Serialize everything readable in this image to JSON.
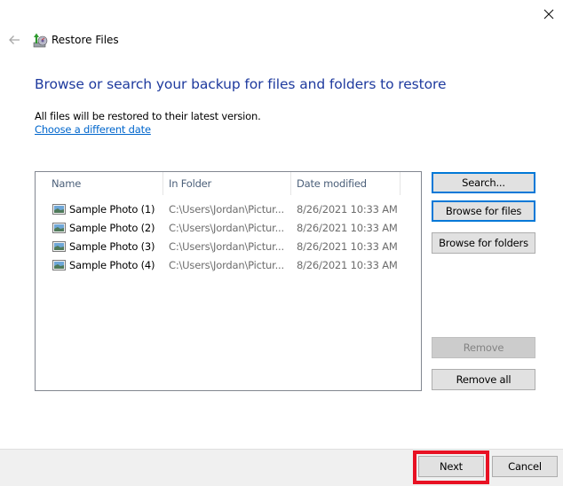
{
  "window": {
    "title": "Restore Files",
    "close_icon": "close-icon",
    "back_icon": "back-arrow-icon",
    "app_icon": "restore-files-icon"
  },
  "main": {
    "heading": "Browse or search your backup for files and folders to restore",
    "info_text": "All files will be restored to their latest version.",
    "date_link": "Choose a different date"
  },
  "file_list": {
    "columns": [
      "Name",
      "In Folder",
      "Date modified"
    ],
    "rows": [
      {
        "icon": "image-file-icon",
        "name": "Sample Photo (1)",
        "folder": "C:\\Users\\Jordan\\Pictur...",
        "date": "8/26/2021 10:33 AM"
      },
      {
        "icon": "image-file-icon",
        "name": "Sample Photo (2)",
        "folder": "C:\\Users\\Jordan\\Pictur...",
        "date": "8/26/2021 10:33 AM"
      },
      {
        "icon": "image-file-icon",
        "name": "Sample Photo (3)",
        "folder": "C:\\Users\\Jordan\\Pictur...",
        "date": "8/26/2021 10:33 AM"
      },
      {
        "icon": "image-file-icon",
        "name": "Sample Photo (4)",
        "folder": "C:\\Users\\Jordan\\Pictur...",
        "date": "8/26/2021 10:33 AM"
      }
    ]
  },
  "side_buttons": {
    "search": "Search...",
    "browse_files": "Browse for files",
    "browse_folders": "Browse for folders",
    "remove": "Remove",
    "remove_all": "Remove all"
  },
  "footer": {
    "next": "Next",
    "cancel": "Cancel"
  },
  "colors": {
    "heading": "#1e3a9e",
    "link": "#0066cc",
    "focus_border": "#0078d7",
    "highlight": "#e81123"
  }
}
